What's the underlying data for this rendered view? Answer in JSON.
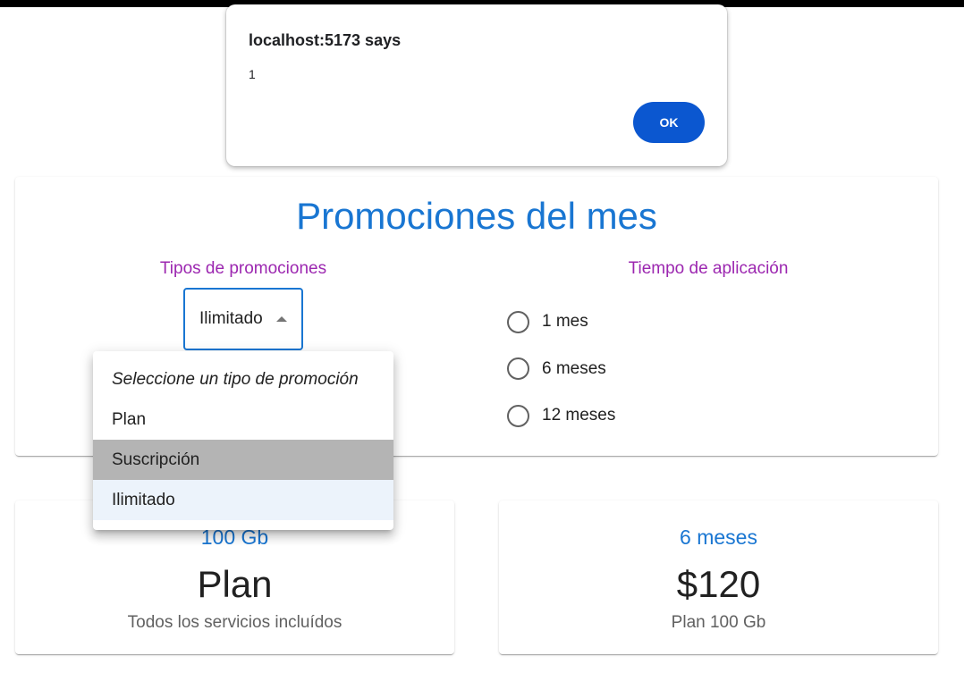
{
  "dialog": {
    "title": "localhost:5173 says",
    "message": "1",
    "ok_label": "OK"
  },
  "promotions": {
    "title": "Promociones del mes",
    "types_label": "Tipos de promociones",
    "time_label": "Tiempo de aplicación",
    "select": {
      "value": "Ilimitado",
      "options": [
        "Seleccione un tipo de promoción",
        "Plan",
        "Suscripción",
        "Ilimitado"
      ],
      "hovered": "Suscripción",
      "selected": "Ilimitado"
    },
    "time_options": [
      "1 mes",
      "6 meses",
      "12 meses"
    ]
  },
  "cards": [
    {
      "subtitle": "100 Gb",
      "headline": "Plan",
      "description": "Todos los servicios incluídos"
    },
    {
      "subtitle": "6 meses",
      "headline": "$120",
      "description": "Plan 100 Gb"
    }
  ],
  "colors": {
    "accent": "#1976d2",
    "section_label": "#9c27b0",
    "dialog_button": "#0b57d0",
    "menu_hover": "#b4b4b4",
    "menu_selected": "#ecf3fb"
  }
}
